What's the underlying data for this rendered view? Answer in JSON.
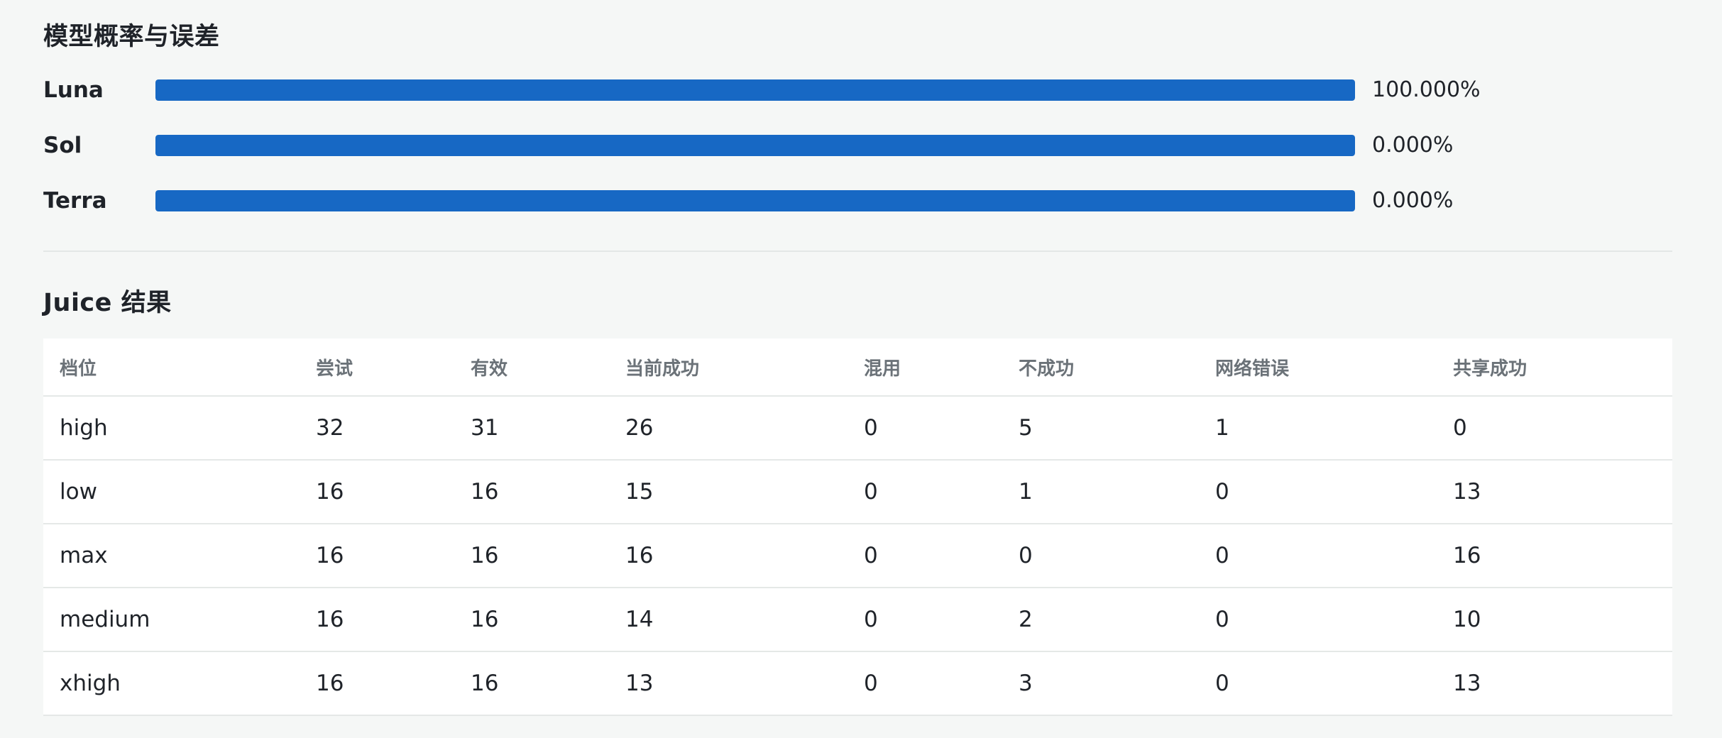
{
  "probabilities": {
    "title": "模型概率与误差",
    "items": [
      {
        "label": "Luna",
        "value_text": "100.000%",
        "fill": 1.0
      },
      {
        "label": "Sol",
        "value_text": "0.000%",
        "fill": 1.0
      },
      {
        "label": "Terra",
        "value_text": "0.000%",
        "fill": 1.0
      }
    ],
    "bar_color": "#1768c4"
  },
  "juice": {
    "title": "Juice 结果",
    "columns": [
      "档位",
      "尝试",
      "有效",
      "当前成功",
      "混用",
      "不成功",
      "网络错误",
      "共享成功"
    ],
    "rows": [
      [
        "high",
        "32",
        "31",
        "26",
        "0",
        "5",
        "1",
        "0"
      ],
      [
        "low",
        "16",
        "16",
        "15",
        "0",
        "1",
        "0",
        "13"
      ],
      [
        "max",
        "16",
        "16",
        "16",
        "0",
        "0",
        "0",
        "16"
      ],
      [
        "medium",
        "16",
        "16",
        "14",
        "0",
        "2",
        "0",
        "10"
      ],
      [
        "xhigh",
        "16",
        "16",
        "13",
        "0",
        "3",
        "0",
        "13"
      ]
    ]
  }
}
